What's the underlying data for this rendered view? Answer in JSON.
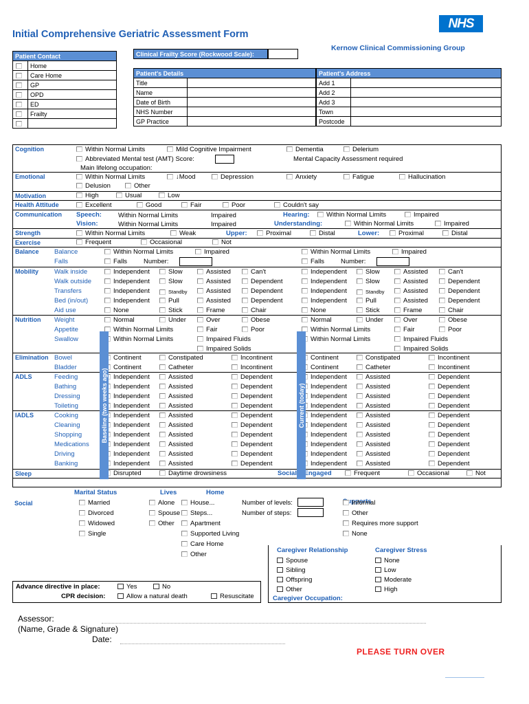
{
  "header": {
    "logo": "NHS",
    "title": "Initial Comprehensive Geriatric Assessment Form",
    "ccg": "Kernow Clinical Commissioning Group"
  },
  "patient_contact": {
    "title": "Patient Contact",
    "items": [
      "Home",
      "Care Home",
      "GP",
      "OPD",
      "ED",
      "Frailty",
      ""
    ]
  },
  "frailty_score": {
    "label": "Clinical Frailty Score (Rockwood Scale):",
    "value": ""
  },
  "patient_details": {
    "title": "Patient's Details",
    "rows": [
      {
        "key": "Title",
        "value": ""
      },
      {
        "key": "Name",
        "value": ""
      },
      {
        "key": "Date of Birth",
        "value": ""
      },
      {
        "key": "NHS Number",
        "value": ""
      },
      {
        "key": "GP Practice",
        "value": ""
      }
    ]
  },
  "patient_address": {
    "title": "Patient's Address",
    "rows": [
      {
        "key": "Add 1",
        "value": ""
      },
      {
        "key": "Add 2",
        "value": ""
      },
      {
        "key": "Add 3",
        "value": ""
      },
      {
        "key": "Town",
        "value": ""
      },
      {
        "key": "Postcode",
        "value": ""
      }
    ]
  },
  "cognition": {
    "name": "Cognition",
    "options": [
      "Within Normal Limits",
      "Mild Cognitive Impairment",
      "Dementia",
      "Delerium"
    ],
    "amt_label": "Abbreviated Mental test (AMT) Score:",
    "amt_value": "",
    "mca_label": "Mental Capacity Assessment required",
    "occupation_label": "Main lifelong occupation:"
  },
  "emotional": {
    "name": "Emotional",
    "row1": [
      "Within Normal Limits",
      "↓Mood",
      "Depression",
      "Anxiety",
      "Fatigue",
      "Hallucination"
    ],
    "row2": [
      "Delusion",
      "Other"
    ]
  },
  "motivation": {
    "name": "Motivation",
    "options": [
      "High",
      "Usual",
      "Low"
    ]
  },
  "health_attitude": {
    "name": "Health Attitude",
    "options": [
      "Excellent",
      "Good",
      "Fair",
      "Poor",
      "Couldn't say"
    ]
  },
  "communication": {
    "name": "Communication",
    "speech_label": "Speech:",
    "vision_label": "Vision:",
    "hearing_label": "Hearing:",
    "understanding_label": "Understanding:",
    "wnl": "Within Normal Limits",
    "impaired": "Impaired"
  },
  "strength": {
    "name": "Strength",
    "options": [
      "Within Normal Limits",
      "Weak"
    ],
    "upper_label": "Upper:",
    "lower_label": "Lower:",
    "sites": [
      "Proximal",
      "Distal"
    ]
  },
  "exercise": {
    "name": "Exercise",
    "options": [
      "Frequent",
      "Occasional",
      "Not"
    ]
  },
  "bands": {
    "baseline": "Baseline (two weeks ago)",
    "current": "Current (today)"
  },
  "balance": {
    "name": "Balance",
    "rows": [
      {
        "sub": "Balance",
        "options": [
          "Within Normal Limits",
          "Impaired"
        ]
      },
      {
        "sub": "Falls",
        "options": [
          "Falls"
        ],
        "number_label": "Number:",
        "number_value": ""
      }
    ]
  },
  "mobility": {
    "name": "Mobility",
    "rows": [
      {
        "sub": "Walk inside",
        "options": [
          "Independent",
          "Slow",
          "Assisted",
          "Can't"
        ]
      },
      {
        "sub": "Walk outside",
        "options": [
          "Independent",
          "Slow",
          "Assisted",
          "Dependent"
        ]
      },
      {
        "sub": "Transfers",
        "options": [
          "Independent",
          "Standby",
          "Assisted",
          "Dependent"
        ]
      },
      {
        "sub": "Bed (in/out)",
        "options": [
          "Independent",
          "Pull",
          "Assisted",
          "Dependent"
        ]
      },
      {
        "sub": "Aid use",
        "options": [
          "None",
          "Stick",
          "Frame",
          "Chair"
        ]
      }
    ]
  },
  "nutrition": {
    "name": "Nutrition",
    "rows": [
      {
        "sub": "Weight",
        "options": [
          "Normal",
          "Under",
          "Over",
          "Obese"
        ]
      },
      {
        "sub": "Appetite",
        "options": [
          "Within Normal Limits",
          "Fair",
          "Poor"
        ]
      },
      {
        "sub": "Swallow",
        "options": [
          "Within Normal Limits",
          "Impaired Fluids"
        ]
      },
      {
        "sub": "",
        "options": [
          "Impaired Solids"
        ]
      }
    ]
  },
  "elimination": {
    "name": "Elimination",
    "rows": [
      {
        "sub": "Bowel",
        "options": [
          "Continent",
          "Constipated",
          "Incontinent"
        ]
      },
      {
        "sub": "Bladder",
        "options": [
          "Continent",
          "Catheter",
          "Incontinent"
        ]
      }
    ]
  },
  "adls": {
    "name": "ADLS",
    "rows": [
      {
        "sub": "Feeding",
        "options": [
          "Independent",
          "Assisted",
          "Dependent"
        ]
      },
      {
        "sub": "Bathing",
        "options": [
          "Independent",
          "Assisted",
          "Dependent"
        ]
      },
      {
        "sub": "Dressing",
        "options": [
          "Independent",
          "Assisted",
          "Dependent"
        ]
      },
      {
        "sub": "Toileting",
        "options": [
          "Independent",
          "Assisted",
          "Dependent"
        ]
      }
    ]
  },
  "iadls": {
    "name": "IADLS",
    "rows": [
      {
        "sub": "Cooking",
        "options": [
          "Independent",
          "Assisted",
          "Dependent"
        ]
      },
      {
        "sub": "Cleaning",
        "options": [
          "Independent",
          "Assisted",
          "Dependent"
        ]
      },
      {
        "sub": "Shopping",
        "options": [
          "Independent",
          "Assisted",
          "Dependent"
        ]
      },
      {
        "sub": "Medications",
        "options": [
          "Independent",
          "Assisted",
          "Dependent"
        ]
      },
      {
        "sub": "Driving",
        "options": [
          "Independent",
          "Assisted",
          "Dependent"
        ]
      },
      {
        "sub": "Banking",
        "options": [
          "Independent",
          "Assisted",
          "Dependent"
        ]
      }
    ]
  },
  "sleep": {
    "name": "Sleep",
    "options": [
      "Disrupted",
      "Daytime drowsiness"
    ],
    "socially_engaged_label": "Socially Engaged",
    "socially_engaged_options": [
      "Frequent",
      "Occasional",
      "Not"
    ]
  },
  "social": {
    "name": "Social",
    "marital_status": {
      "title": "Marital Status",
      "options": [
        "Married",
        "Divorced",
        "Widowed",
        "Single"
      ]
    },
    "lives": {
      "title": "Lives",
      "options": [
        "Alone",
        "Spouse",
        "Other"
      ]
    },
    "home": {
      "title": "Home",
      "options": [
        "House...",
        "Steps...",
        "Apartment",
        "Supported Living",
        "Care Home",
        "Other"
      ]
    },
    "levels_label": "Number of levels:",
    "levels_value": "",
    "steps_label": "Number of steps:",
    "steps_value": "",
    "supports": {
      "title": "Supports",
      "options": [
        "Informal",
        "Other",
        "Requires more support",
        "None"
      ]
    }
  },
  "caregiver": {
    "relationship": {
      "title": "Caregiver Relationship",
      "options": [
        "Spouse",
        "Sibling",
        "Offspring",
        "Other"
      ]
    },
    "stress": {
      "title": "Caregiver Stress",
      "options": [
        "None",
        "Low",
        "Moderate",
        "High"
      ]
    },
    "occupation_label": "Caregiver Occupation:"
  },
  "advance": {
    "directive_label": "Advance directive in place:",
    "directive_options": [
      "Yes",
      "No"
    ],
    "cpr_label": "CPR decision:",
    "cpr_options": [
      "Allow a natural death",
      "Resuscitate"
    ]
  },
  "footer": {
    "assessor_label": "Assessor:",
    "assessor_sub": "(Name, Grade & Signature)",
    "date_label": "Date:",
    "turn_over": "PLEASE TURN OVER"
  }
}
